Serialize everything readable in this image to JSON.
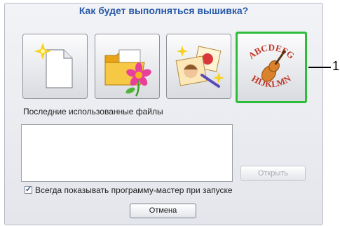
{
  "dialog": {
    "title": "Как будет выполняться вышивка?",
    "options": [
      {
        "icon": "new-file-icon"
      },
      {
        "icon": "open-folder-flower-icon"
      },
      {
        "icon": "photo-wizard-icon"
      },
      {
        "icon": "lettering-violin-icon",
        "selected": true,
        "text_top": "ABCDEFG",
        "text_bottom": "HIJKLMN"
      }
    ],
    "callout_number": "1",
    "recent_label": "Последние использованные файлы",
    "open_button": "Открыть",
    "checkbox_label": "Всегда показывать программу-мастер при запуске",
    "checkbox_checked": true,
    "cancel_button": "Отмена"
  },
  "colors": {
    "title": "#2a5aa8",
    "selection_border": "#2ebd38",
    "lettering_red": "#c0392b"
  }
}
